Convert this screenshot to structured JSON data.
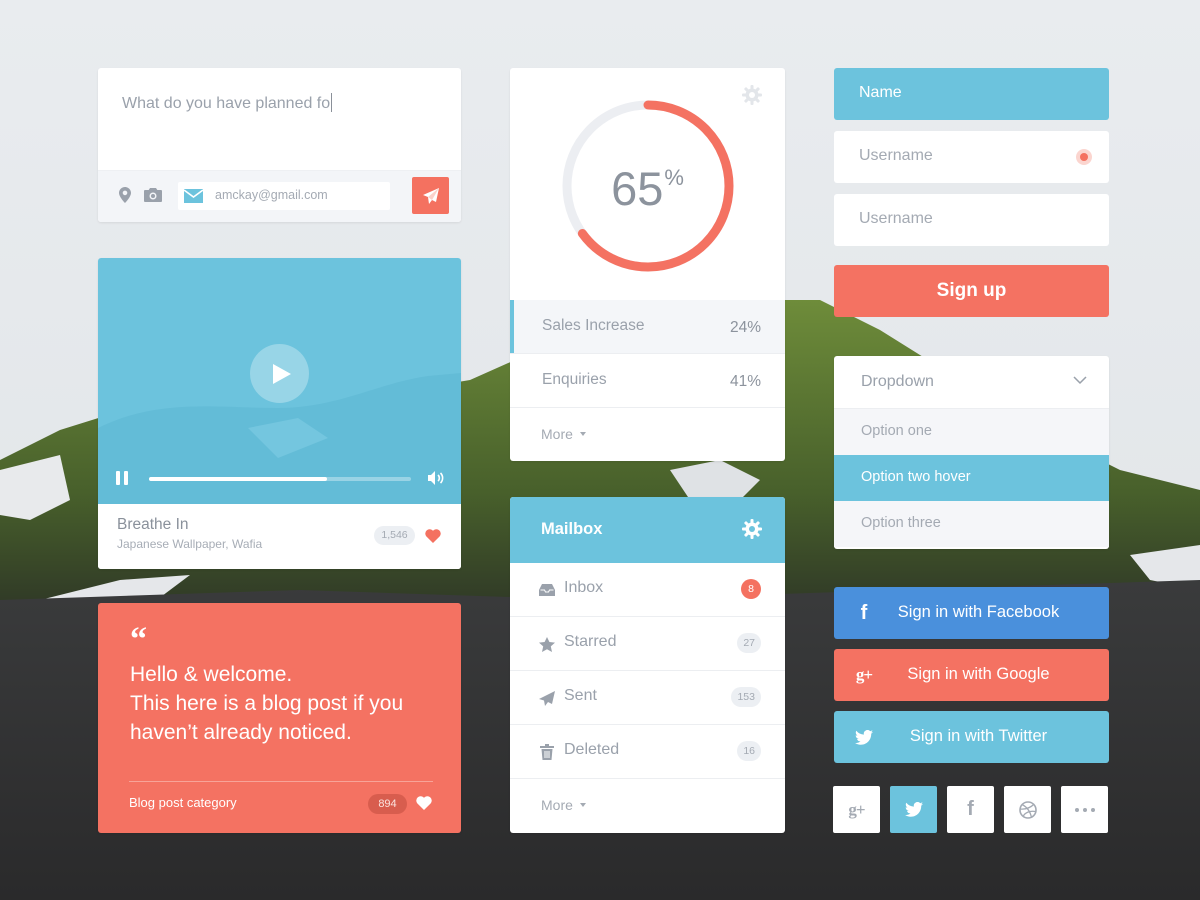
{
  "composer": {
    "text": "What do you have planned fo",
    "email": "amckay@gmail.com",
    "icons": [
      "location-pin-icon",
      "camera-icon",
      "envelope-icon",
      "paper-plane-icon"
    ]
  },
  "video": {
    "title": "Breathe In",
    "subtitle": "Japanese Wallpaper, Wafia",
    "likes": "1,546",
    "progress_percent": 68
  },
  "quote": {
    "quote_mark": "“",
    "line1": "Hello & welcome.",
    "line2": "This here is a blog post if you haven’t already noticed.",
    "category": "Blog post category",
    "likes": "894"
  },
  "progress": {
    "value": 65,
    "value_label": "65",
    "unit": "%",
    "stats": [
      {
        "label": "Sales Increase",
        "value": "24%"
      },
      {
        "label": "Enquiries",
        "value": "41%"
      }
    ],
    "more_label": "More"
  },
  "mailbox": {
    "title": "Mailbox",
    "items": [
      {
        "label": "Inbox",
        "count": "8",
        "icon": "inbox-icon"
      },
      {
        "label": "Starred",
        "count": "27",
        "icon": "star-icon"
      },
      {
        "label": "Sent",
        "count": "153",
        "icon": "paper-plane-icon"
      },
      {
        "label": "Deleted",
        "count": "16",
        "icon": "trash-icon"
      }
    ],
    "more_label": "More"
  },
  "signup": {
    "name_field": "Name",
    "username_placeholder_1": "Username",
    "username_placeholder_2": "Username",
    "submit_label": "Sign up"
  },
  "dropdown": {
    "label": "Dropdown",
    "options": [
      "Option one",
      "Option two hover",
      "Option three"
    ],
    "hovered_index": 1
  },
  "social": {
    "facebook_label": "Sign in with Facebook",
    "google_label": "Sign in with Google",
    "twitter_label": "Sign in with Twitter",
    "share_icons": [
      "google-plus-icon",
      "twitter-icon",
      "facebook-icon",
      "dribbble-icon",
      "more-icon"
    ],
    "active_share": "twitter"
  },
  "colors": {
    "accent_blue": "#6cc3dd",
    "accent_coral": "#f47262",
    "facebook_blue": "#4a90dc",
    "text_gray": "#9aa1ab"
  }
}
